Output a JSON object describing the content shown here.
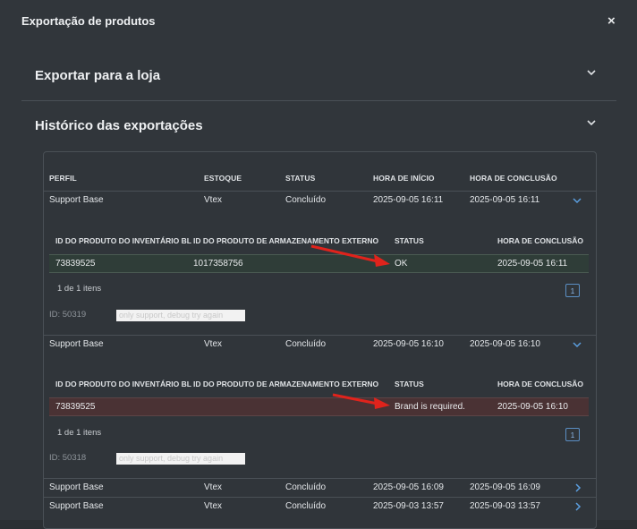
{
  "modal": {
    "title": "Exportação de produtos",
    "close": "×"
  },
  "sections": {
    "export_to_store": "Exportar para a loja",
    "history": "Histórico das exportações"
  },
  "history_table": {
    "headers": [
      "PERFIL",
      "ESTOQUE",
      "STATUS",
      "HORA DE INÍCIO",
      "HORA DE CONCLUSÃO"
    ],
    "rows": [
      {
        "profile": "Support Base",
        "stock": "Vtex",
        "status": "Concluído",
        "start": "2025-09-05 16:11",
        "end": "2025-09-05 16:11",
        "expanded": true
      },
      {
        "profile": "Support Base",
        "stock": "Vtex",
        "status": "Concluído",
        "start": "2025-09-05 16:10",
        "end": "2025-09-05 16:10",
        "expanded": true
      },
      {
        "profile": "Support Base",
        "stock": "Vtex",
        "status": "Concluído",
        "start": "2025-09-05 16:09",
        "end": "2025-09-05 16:09",
        "expanded": false
      },
      {
        "profile": "Support Base",
        "stock": "Vtex",
        "status": "Concluído",
        "start": "2025-09-03 13:57",
        "end": "2025-09-03 13:57",
        "expanded": false
      }
    ]
  },
  "detail_headers": [
    "ID DO PRODUTO DO INVENTÁRIO BL",
    "ID DO PRODUTO DE ARMAZENAMENTO EXTERNO",
    "STATUS",
    "HORA DE CONCLUSÃO"
  ],
  "details": [
    {
      "product_id": "73839525",
      "external_id": "1017358756",
      "status": "OK",
      "end": "2025-09-05 16:11",
      "items": "1 de 1 itens",
      "page": "1",
      "id_label": "ID: 50319",
      "note": "only support, debug try again"
    },
    {
      "product_id": "73839525",
      "external_id": "",
      "status": "Brand is required.",
      "end": "2025-09-05 16:10",
      "items": "1 de 1 itens",
      "page": "1",
      "id_label": "ID: 50318",
      "note": "only support, debug try again"
    }
  ],
  "colors": {
    "accent": "#5b8fc4",
    "ok_row": "#2f3d38",
    "error_row": "#4a3234",
    "annotation_arrow": "#e0231c"
  }
}
